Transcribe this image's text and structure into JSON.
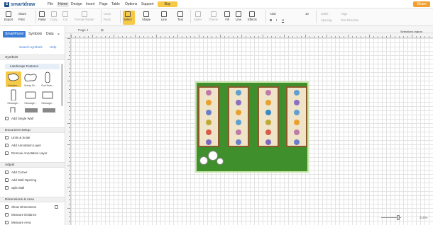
{
  "app": {
    "logo_text": "smartdraw",
    "logo_mark": "S"
  },
  "menu": {
    "items": [
      "File",
      "Home",
      "Design",
      "Insert",
      "Page",
      "Table",
      "Options",
      "Support"
    ],
    "active": "Home",
    "buy": "Buy",
    "share": "Share"
  },
  "ribbon": {
    "export": "Export",
    "share": "Share",
    "print": "Print",
    "paste": "Paste",
    "copy": "Copy",
    "cut": "Cut",
    "format_painter": "Format Painter",
    "undo": "Undo",
    "redo": "Redo",
    "select": "Select",
    "shape": "Shape",
    "line": "Line",
    "text": "Text",
    "styles": "Styles",
    "theme": "Theme",
    "fill": "Fill",
    "line2": "Line",
    "effects": "Effects",
    "font": "Arial",
    "size": "10",
    "bullet": "Bullet",
    "align": "Align",
    "spacing": "Spacing",
    "text_direction": "Text Direction"
  },
  "left_panel": {
    "tabs": [
      "SmartPanel",
      "Symbols",
      "Data"
    ],
    "search": "Search symbols",
    "help": "Help",
    "symbols_header": "Symbols",
    "library": "Landscape Features",
    "shapes": [
      "Freeform...",
      "Kidney Sh...",
      "Oval Swim...",
      "Rectangle...",
      "Rectangle...",
      "Rectangle...",
      "",
      "",
      ""
    ],
    "add_single_wall": "Add Single Wall",
    "doc_setup_header": "Document Setup",
    "units_scale": "Units & Scale",
    "add_annotation": "Add Annotation Layer",
    "remove_annotation": "Remove Annotation Layer",
    "adjust_header": "Adjust",
    "add_corner": "Add Corner",
    "add_wall_opening": "Add Wall Opening",
    "split_wall": "Split Wall",
    "dim_header": "Dimensions & Area",
    "show_dimensions": "Show Dimensions",
    "measure_distance": "Measure Distance",
    "measure_area": "Measure Area"
  },
  "canvas": {
    "page_tab": "Page 1",
    "selection": "Selections Ingrun",
    "zoom": "210%"
  },
  "colors": {
    "accent": "#3a7bd5",
    "buy": "#f7c948",
    "grass": "#3f8f2c"
  }
}
